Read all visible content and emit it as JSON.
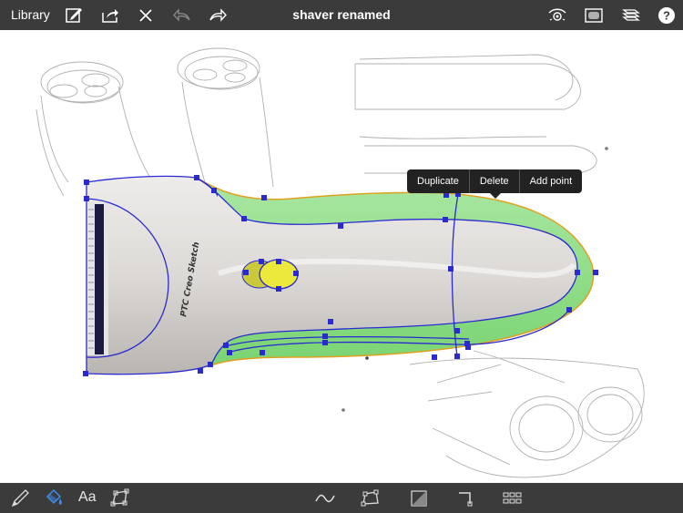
{
  "header": {
    "library_label": "Library",
    "title": "shaver renamed",
    "icons": [
      "edit-icon",
      "share-icon",
      "close-icon",
      "undo-icon",
      "redo-icon",
      "visibility-icon",
      "canvas-icon",
      "layers-icon",
      "help-icon"
    ]
  },
  "canvas": {
    "sketch_text": "PTC Creo Sketch"
  },
  "context_menu": {
    "items": [
      "Duplicate",
      "Delete",
      "Add point"
    ]
  },
  "toolbar": {
    "text_tool_label": "Aa",
    "icons": [
      "pen-icon",
      "fill-icon",
      "text-icon",
      "shape-icon",
      "curve-icon",
      "polygon-icon",
      "shading-icon",
      "corner-icon",
      "grid-icon"
    ]
  },
  "colors": {
    "bar": "#3b3b3b",
    "shape_outline": "#2a2ad0",
    "green_fill": "#8fdd8a",
    "yellow": "#e4e03c"
  }
}
